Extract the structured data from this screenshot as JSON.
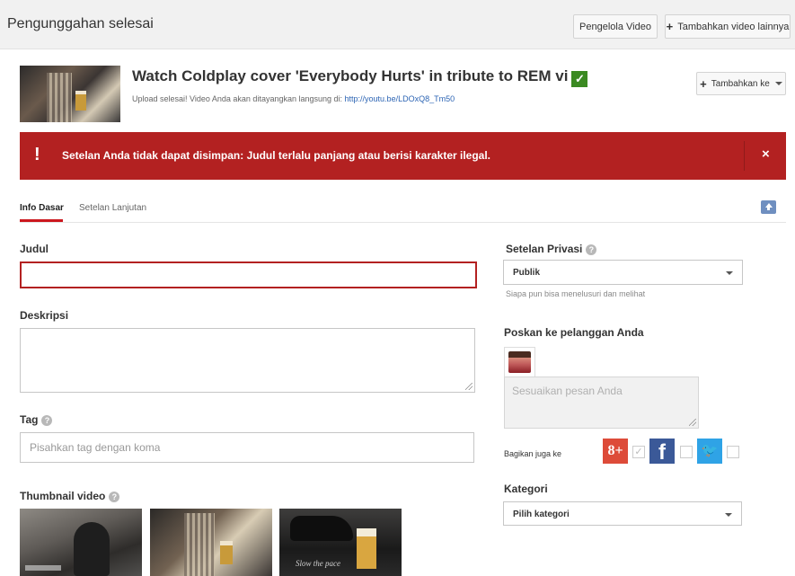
{
  "header": {
    "title": "Pengunggahan selesai",
    "video_manager_label": "Pengelola Video",
    "add_more_label": "Tambahkan video lainnya"
  },
  "video": {
    "title": "Watch Coldplay cover 'Everybody Hurts' in tribute to REM vi",
    "upload_message": "Upload selesai! Video Anda akan ditayangkan langsung di:",
    "link": "http://youtu.be/LDOxQ8_Tm50",
    "add_to_label": "Tambahkan ke"
  },
  "error": {
    "icon": "!",
    "message": "Setelan Anda tidak dapat disimpan: Judul terlalu panjang atau berisi karakter ilegal.",
    "close": "×"
  },
  "tabs": [
    {
      "label": "Info Dasar",
      "active": true
    },
    {
      "label": "Setelan Lanjutan",
      "active": false
    }
  ],
  "form": {
    "title_label": "Judul",
    "title_value": "",
    "description_label": "Deskripsi",
    "description_value": "",
    "tags_label": "Tag",
    "tags_placeholder": "Pisahkan tag dengan koma",
    "thumbnail_label": "Thumbnail video",
    "thumbnail_slogan": "Slow the pace"
  },
  "privacy": {
    "label": "Setelan Privasi",
    "selected": "Publik",
    "hint": "Siapa pun bisa menelusuri dan melihat"
  },
  "post": {
    "label": "Poskan ke pelanggan Anda",
    "message_placeholder": "Sesuaikan pesan Anda",
    "share_label": "Bagikan juga ke",
    "networks": [
      "google-plus",
      "facebook",
      "twitter"
    ]
  },
  "category": {
    "label": "Kategori",
    "selected": "Pilih kategori"
  },
  "colors": {
    "error_red": "#b32121",
    "link_blue": "#2d65b4",
    "check_green": "#3b8a22"
  }
}
